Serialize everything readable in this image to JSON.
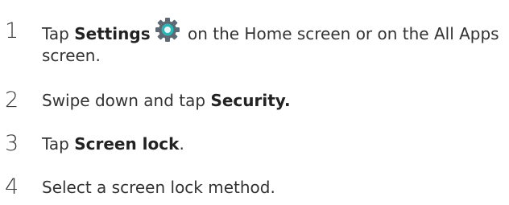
{
  "steps": [
    {
      "number": "1",
      "prefix": "Tap ",
      "bold": "Settings",
      "icon": "settings-gear-icon",
      "suffix": " on the Home screen or on the All Apps screen."
    },
    {
      "number": "2",
      "prefix": "Swipe down and tap ",
      "bold": "Security.",
      "suffix": ""
    },
    {
      "number": "3",
      "prefix": "Tap ",
      "bold": "Screen lock",
      "suffix": "."
    },
    {
      "number": "4",
      "prefix": "Select a screen lock method.",
      "bold": "",
      "suffix": ""
    }
  ],
  "colors": {
    "text": "#333333",
    "icon_outer": "#5e6a73",
    "icon_inner": "#2bb5b5"
  }
}
